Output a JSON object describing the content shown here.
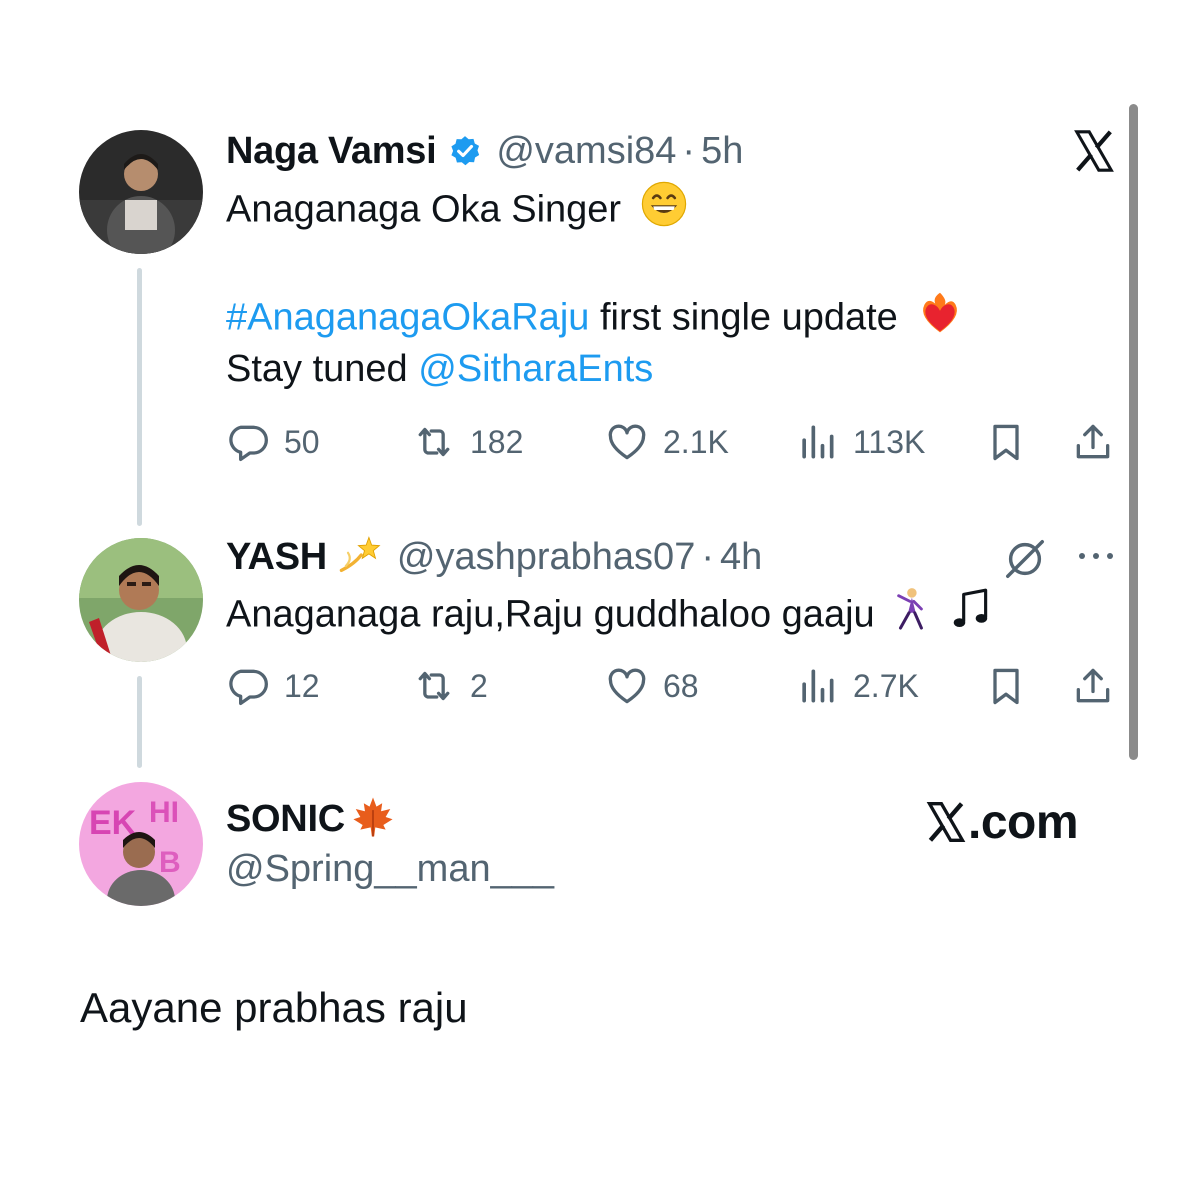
{
  "tweet1": {
    "name": "Naga Vamsi",
    "handle": "@vamsi84",
    "sep": "·",
    "time": "5h",
    "line1": "Anaganaga Oka Singer",
    "hashtag": "#AnaganagaOkaRaju",
    "line2_rest": "first single update",
    "line3_prefix": "Stay tuned",
    "mention": "@SitharaEnts",
    "replies": "50",
    "retweets": "182",
    "likes": "2.1K",
    "views": "113K"
  },
  "tweet2": {
    "name": "YASH",
    "handle": "@yashprabhas07",
    "sep": "·",
    "time": "4h",
    "text": "Anaganaga raju,Raju guddhaloo gaaju",
    "replies": "12",
    "retweets": "2",
    "likes": "68",
    "views": "2.7K"
  },
  "reply": {
    "name": "SONIC",
    "handle": "@Spring__man___",
    "text": "Aayane prabhas raju"
  },
  "brand": {
    "domain": ".com",
    "x_logo": "x-logo-icon"
  },
  "colors": {
    "link": "#1d9bf0",
    "muted": "#536471",
    "verified": "#1d9bf0",
    "thread": "#cfd9de"
  }
}
